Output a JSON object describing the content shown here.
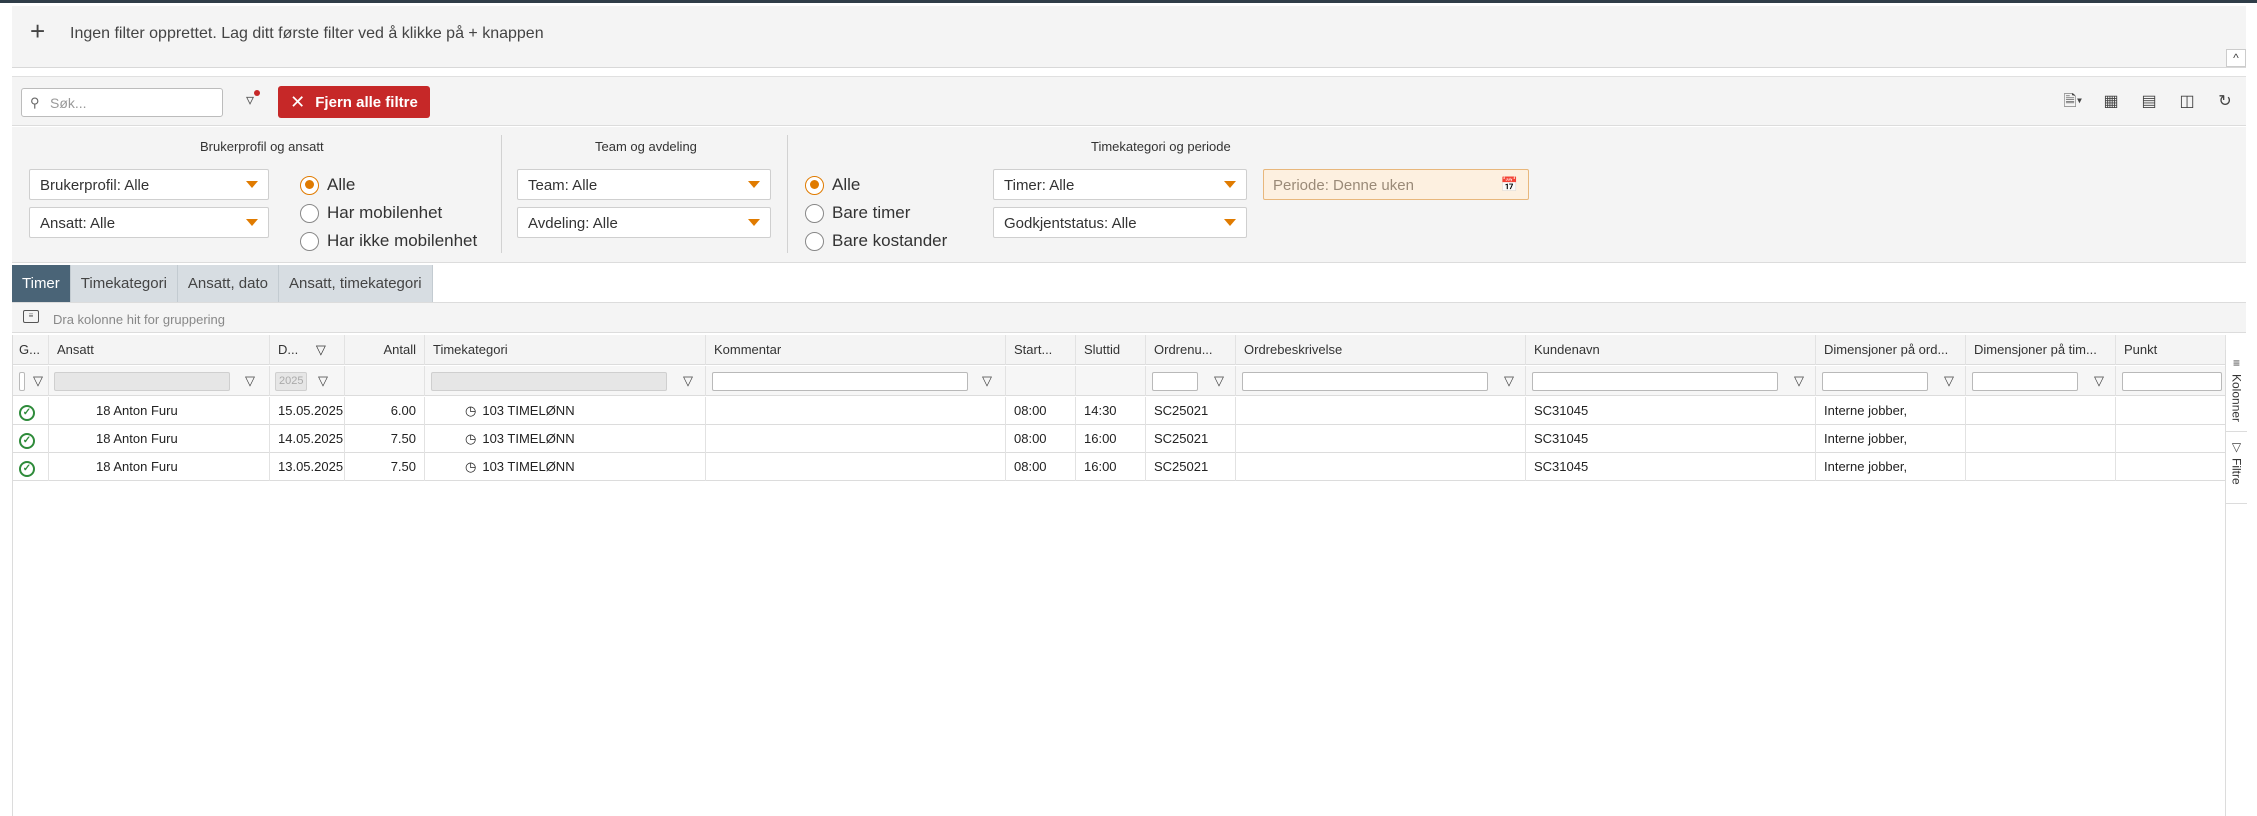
{
  "filter_bar": {
    "message": "Ingen filter opprettet. Lag ditt første filter ved å klikke på + knappen",
    "add_symbol": "+",
    "collapse_symbol": "^"
  },
  "toolbar": {
    "search_placeholder": "Søk...",
    "clear_filters_label": "Fjern alle filtre",
    "icons": [
      "export-icon",
      "excel-icon",
      "layout-icon",
      "columns-icon",
      "refresh-icon"
    ]
  },
  "filters": {
    "group1_title": "Brukerprofil og ansatt",
    "brukerprofil": "Brukerprofil: Alle",
    "ansatt": "Ansatt: Alle",
    "mobile_options": [
      "Alle",
      "Har mobilenhet",
      "Har ikke mobilenhet"
    ],
    "mobile_selected": "Alle",
    "group2_title": "Team og avdeling",
    "team": "Team: Alle",
    "avdeling": "Avdeling: Alle",
    "group3_title": "Timekategori og periode",
    "type_options": [
      "Alle",
      "Bare timer",
      "Bare kostander"
    ],
    "type_selected": "Alle",
    "timer": "Timer: Alle",
    "godkjent": "Godkjentstatus: Alle",
    "periode": "Periode: Denne uken"
  },
  "tabs": [
    "Timer",
    "Timekategori",
    "Ansatt, dato",
    "Ansatt, timekategori"
  ],
  "active_tab": "Timer",
  "grouping_hint": "Dra kolonne hit for gruppering",
  "columns": {
    "g": "G...",
    "ansatt": "Ansatt",
    "dato": "D...",
    "antall": "Antall",
    "timekategori": "Timekategori",
    "kommentar": "Kommentar",
    "start": "Start...",
    "sluttid": "Sluttid",
    "ordrenr": "Ordrenu...",
    "ordrebeskrivelse": "Ordrebeskrivelse",
    "kundenavn": "Kundenavn",
    "dim_ordre": "Dimensjoner på ord...",
    "dim_time": "Dimensjoner på tim...",
    "punkt": "Punkt"
  },
  "date_filter_value": "2025",
  "rows": [
    {
      "ansatt": "18 Anton Furu",
      "dato": "15.05.2025",
      "antall": "6.00",
      "timekategori": "103 TIMELØNN",
      "kommentar": "",
      "start": "08:00",
      "slutt": "14:30",
      "ordrenr": "SC25021",
      "ordrebeskrivelse": "",
      "kundenavn": "SC31045",
      "dim_ordre": "Interne jobber,",
      "dim_time": "",
      "punkt": ""
    },
    {
      "ansatt": "18 Anton Furu",
      "dato": "14.05.2025",
      "antall": "7.50",
      "timekategori": "103 TIMELØNN",
      "kommentar": "",
      "start": "08:00",
      "slutt": "16:00",
      "ordrenr": "SC25021",
      "ordrebeskrivelse": "",
      "kundenavn": "SC31045",
      "dim_ordre": "Interne jobber,",
      "dim_time": "",
      "punkt": ""
    },
    {
      "ansatt": "18 Anton Furu",
      "dato": "13.05.2025",
      "antall": "7.50",
      "timekategori": "103 TIMELØNN",
      "kommentar": "",
      "start": "08:00",
      "slutt": "16:00",
      "ordrenr": "SC25021",
      "ordrebeskrivelse": "",
      "kundenavn": "SC31045",
      "dim_ordre": "Interne jobber,",
      "dim_time": "",
      "punkt": ""
    }
  ],
  "side_panel": {
    "columns_label": "Kolonner",
    "filters_label": "Filtre"
  },
  "colors": {
    "accent": "#e07b00",
    "danger": "#c62828",
    "tab_active": "#4a6477",
    "approved": "#2e8b3a"
  }
}
